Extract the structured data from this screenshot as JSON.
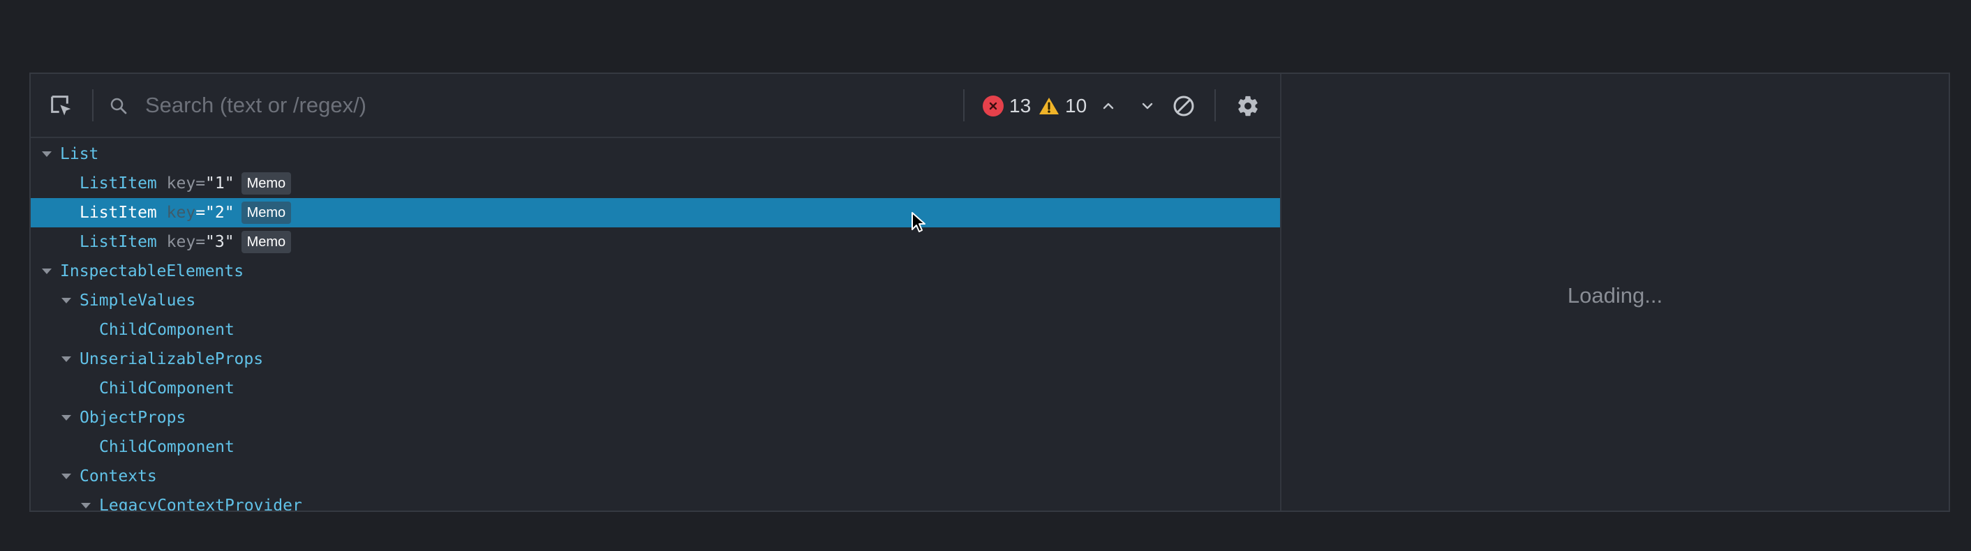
{
  "toolbar": {
    "search_placeholder": "Search (text or /regex/)",
    "error_count": "13",
    "warning_count": "10",
    "icons": {
      "inspect": "inspect-element-icon",
      "search": "search-icon",
      "error": "error-icon",
      "warning": "warning-icon",
      "prev": "chevron-up-icon",
      "next": "chevron-down-icon",
      "clear": "clear-icon",
      "settings": "gear-icon"
    }
  },
  "tree": {
    "rows": [
      {
        "name": "List",
        "depth": 0,
        "expanded": true
      },
      {
        "name": "ListItem",
        "key_label": "key",
        "key_value": "\"1\"",
        "badge": "Memo",
        "depth": 1
      },
      {
        "name": "ListItem",
        "key_label": "key",
        "key_value": "\"2\"",
        "badge": "Memo",
        "depth": 1,
        "selected": true
      },
      {
        "name": "ListItem",
        "key_label": "key",
        "key_value": "\"3\"",
        "badge": "Memo",
        "depth": 1
      },
      {
        "name": "InspectableElements",
        "depth": 0,
        "expanded": true
      },
      {
        "name": "SimpleValues",
        "depth": 1,
        "expanded": true
      },
      {
        "name": "ChildComponent",
        "depth": 2
      },
      {
        "name": "UnserializableProps",
        "depth": 1,
        "expanded": true
      },
      {
        "name": "ChildComponent",
        "depth": 2
      },
      {
        "name": "ObjectProps",
        "depth": 1,
        "expanded": true
      },
      {
        "name": "ChildComponent",
        "depth": 2
      },
      {
        "name": "Contexts",
        "depth": 1,
        "expanded": true
      },
      {
        "name": "LegacyContextProvider",
        "depth": 2,
        "expanded": true
      }
    ]
  },
  "detail": {
    "loading_text": "Loading..."
  },
  "colors": {
    "background": "#1e2025",
    "panel": "#23262d",
    "component_name": "#61c2e8",
    "selection": "#1a80b0",
    "error": "#e5414b",
    "warning": "#f0b429"
  }
}
